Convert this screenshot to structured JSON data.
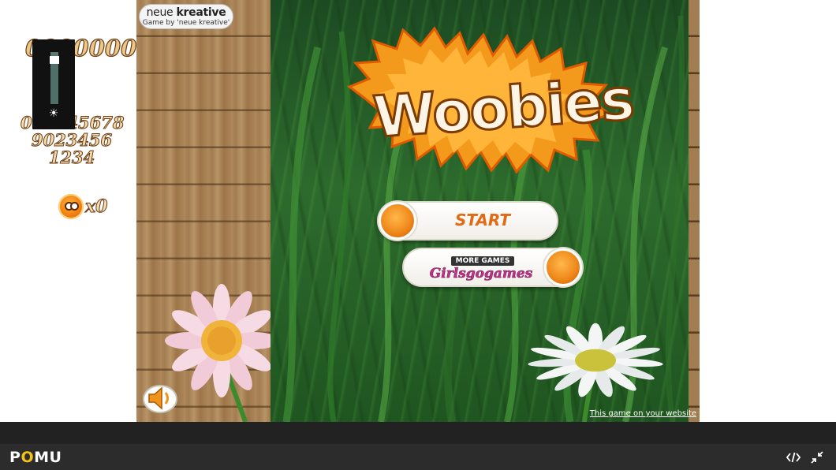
{
  "score_panel": {
    "score": "0000000",
    "digit_strip": [
      "012345678",
      "9023456",
      "1234"
    ],
    "lives_count": "x0"
  },
  "volume": {
    "level": 0.85
  },
  "game": {
    "credit_brand_light": "neue ",
    "credit_brand_bold": "kreative",
    "credit_subtitle": "Game by 'neue kreative'",
    "logo_text": "Woobies",
    "start_label": "START",
    "more_games_label": "MORE GAMES",
    "more_games_brand": "Girlsgogames",
    "embed_link": "This game on your website"
  },
  "footer": {
    "brand_p": "P",
    "brand_o": "O",
    "brand_rest": "MU"
  },
  "colors": {
    "accent_orange": "#e36a15",
    "brand_pink": "#c0338a",
    "footer_bg": "#2c2c2c",
    "brand_yellow": "#f3c218"
  },
  "icons": [
    "sun-icon",
    "woobie-ball-icon",
    "speaker-icon",
    "code-icon",
    "collapse-icon"
  ]
}
